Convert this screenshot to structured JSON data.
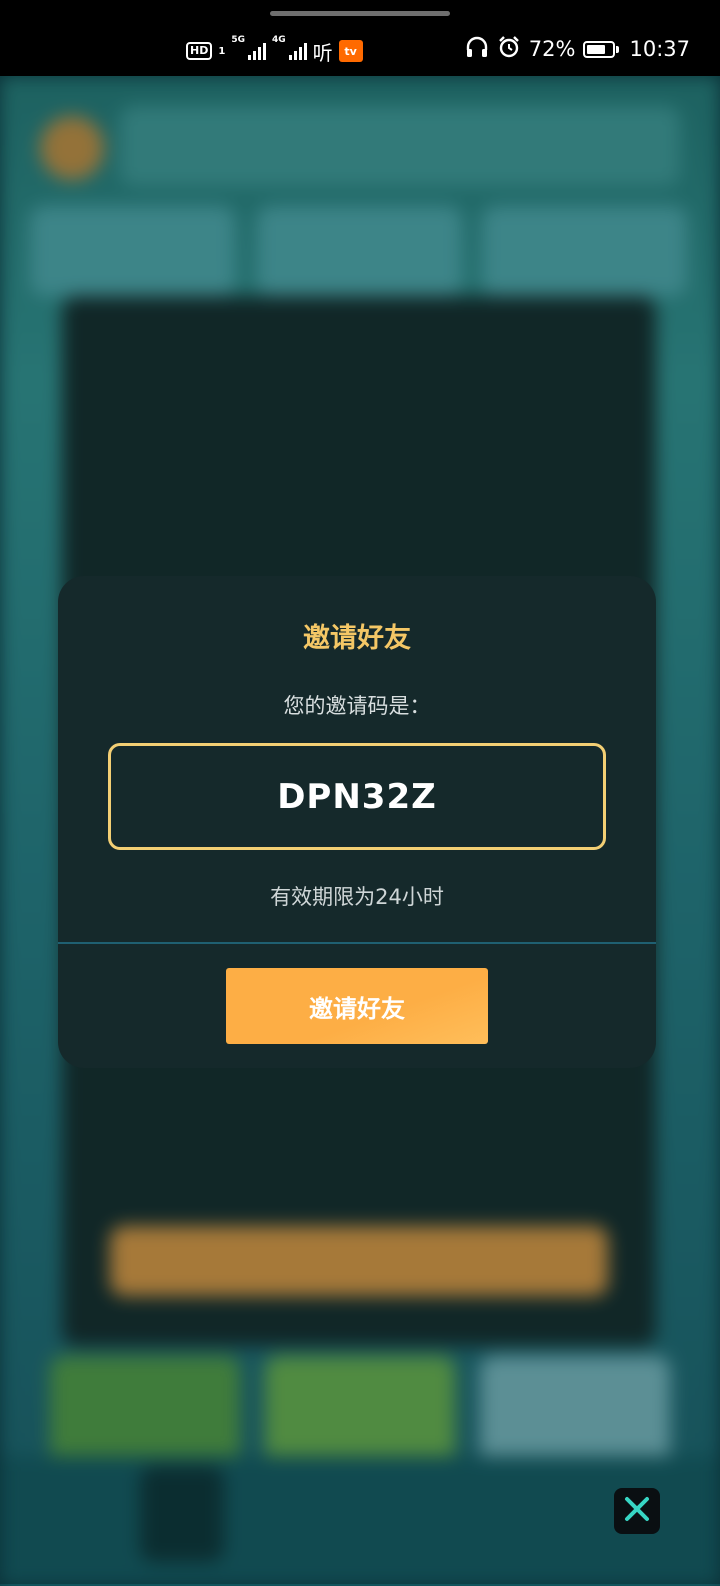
{
  "status_bar": {
    "hd_label": "HD",
    "sim_index": "1",
    "net_1": "5G",
    "net_2": "4G",
    "app_text": "听",
    "app_badge": "tv",
    "battery_percent": "72%",
    "battery_level": 0.72,
    "time": "10:37"
  },
  "dialog": {
    "title": "邀请好友",
    "subtitle": "您的邀请码是：",
    "invite_code": "DPN32Z",
    "validity": "有效期限为24小时",
    "invite_button_label": "邀请好友"
  },
  "icons": {
    "headphones": "headphones-icon",
    "alarm": "alarm-icon",
    "battery": "battery-icon",
    "close": "close-icon"
  },
  "colors": {
    "title_gold": "#f4c766",
    "code_border": "#f3cf74",
    "button_orange": "#fdae45",
    "dialog_bg": "#15292b",
    "close_accent": "#37d6c4"
  }
}
